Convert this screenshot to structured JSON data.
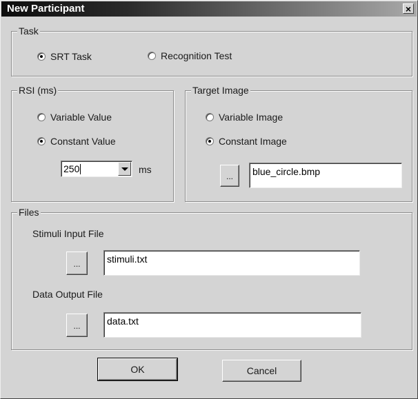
{
  "window": {
    "title": "New Participant",
    "close_glyph": "×"
  },
  "task": {
    "legend": "Task",
    "options": [
      {
        "label": "SRT Task",
        "checked": true
      },
      {
        "label": "Recognition Test",
        "checked": false
      }
    ]
  },
  "rsi": {
    "legend": "RSI (ms)",
    "options": [
      {
        "label": "Variable Value",
        "checked": false
      },
      {
        "label": "Constant Value",
        "checked": true
      }
    ],
    "value": "250",
    "unit": "ms"
  },
  "target_image": {
    "legend": "Target Image",
    "options": [
      {
        "label": "Variable Image",
        "checked": false
      },
      {
        "label": "Constant Image",
        "checked": true
      }
    ],
    "browse_label": "...",
    "file": "blue_circle.bmp"
  },
  "files": {
    "legend": "Files",
    "stimuli_label": "Stimuli Input File",
    "stimuli_browse": "...",
    "stimuli_file": "stimuli.txt",
    "data_label": "Data Output File",
    "data_browse": "...",
    "data_file": "data.txt"
  },
  "buttons": {
    "ok": "OK",
    "cancel": "Cancel"
  },
  "icons": {
    "close": "close-icon",
    "dropdown": "chevron-down-icon"
  }
}
